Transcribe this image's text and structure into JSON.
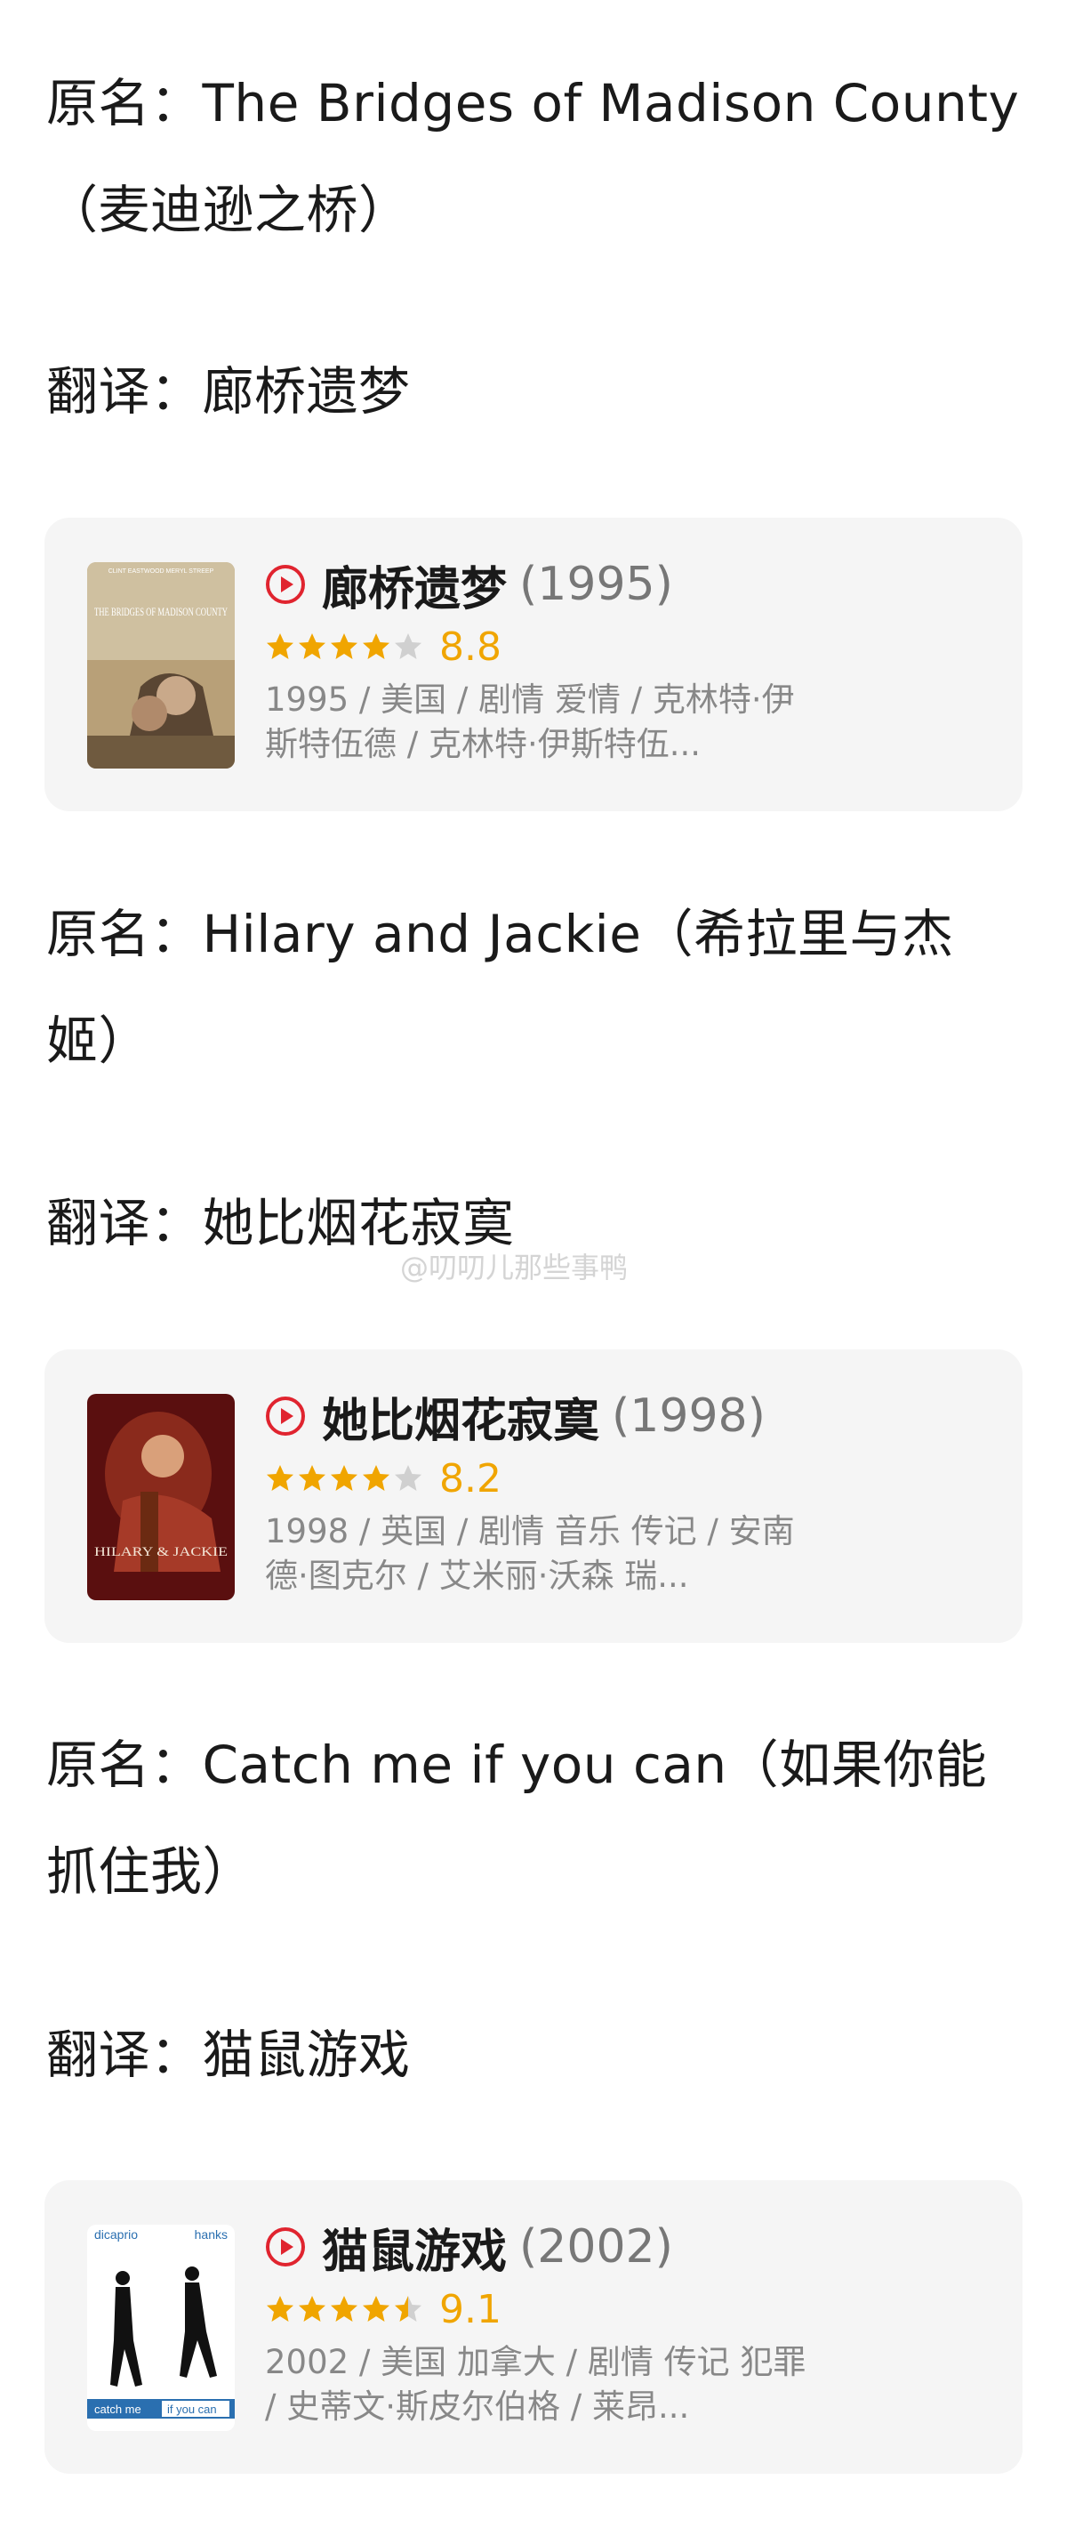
{
  "sections": [
    {
      "original": "原名：The Bridges of Madison County（麦迪逊之桥）",
      "translation": "翻译：廊桥遗梦",
      "card": {
        "title": "廊桥遗梦",
        "year": "(1995)",
        "stars_filled": 4,
        "score": "8.8",
        "meta": "1995 / 美国 / 剧情 爱情 / 克林特·伊斯特伍德 / 克林特·伊斯特伍...",
        "poster": {
          "top_text": "CLINT EASTWOOD    MERYL STREEP",
          "title_text": "THE BRIDGES OF MADISON COUNTY"
        }
      }
    },
    {
      "original": "原名：Hilary and Jackie（希拉里与杰姬）",
      "translation": "翻译：她比烟花寂寞",
      "card": {
        "title": "她比烟花寂寞",
        "year": "(1998)",
        "stars_filled": 4,
        "score": "8.2",
        "meta": "1998 / 英国 / 剧情 音乐 传记 / 安南德·图克尔 / 艾米丽·沃森 瑞...",
        "poster": {
          "title_text": "HILARY & JACKIE"
        }
      }
    },
    {
      "original": "原名：Catch me if you can（如果你能抓住我）",
      "translation": "翻译：猫鼠游戏",
      "card": {
        "title": "猫鼠游戏",
        "year": "(2002)",
        "stars_filled": 4.5,
        "score": "9.1",
        "meta": "2002 / 美国 加拿大 / 剧情 传记 犯罪 / 史蒂文·斯皮尔伯格 / 莱昂...",
        "poster": {
          "left_name": "dicaprio",
          "right_name": "hanks",
          "title_left": "catch me",
          "title_right": "if you can"
        }
      }
    }
  ],
  "watermark": "@叨叨儿那些事鸭",
  "colors": {
    "accent_red": "#e0242f",
    "star_gold": "#f0a500",
    "star_empty": "#d0d0d0",
    "card_bg": "#f5f5f5"
  }
}
